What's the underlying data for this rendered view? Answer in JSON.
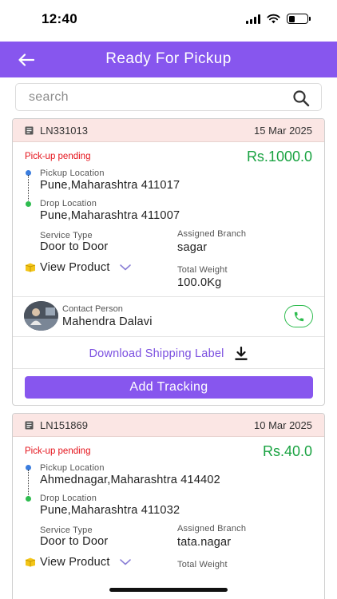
{
  "status_bar": {
    "time": "12:40",
    "battery_level": 0.35
  },
  "header": {
    "title": "Ready For Pickup"
  },
  "search": {
    "placeholder": "search"
  },
  "orders": [
    {
      "id": "LN331013",
      "date": "15 Mar 2025",
      "status": "Pick-up pending",
      "price_prefix": "Rs.",
      "price_amount": "1000.0",
      "pickup_label": "Pickup Location",
      "pickup_value": "Pune,Maharashtra 411017",
      "drop_label": "Drop Location",
      "drop_value": "Pune,Maharashtra 411007",
      "service_type_label": "Service Type",
      "service_type_value": "Door to Door",
      "branch_label": "Assigned Branch",
      "branch_value": "sagar",
      "view_product_label": "View Product",
      "weight_label": "Total Weight",
      "weight_value": "100.0Kg",
      "contact_label": "Contact Person",
      "contact_name": "Mahendra Dalavi",
      "download_label": "Download Shipping Label",
      "add_tracking_label": "Add Tracking"
    },
    {
      "id": "LN151869",
      "date": "10 Mar 2025",
      "status": "Pick-up pending",
      "price_prefix": "Rs.",
      "price_amount": "40.0",
      "pickup_label": "Pickup Location",
      "pickup_value": "Ahmednagar,Maharashtra 414402",
      "drop_label": "Drop Location",
      "drop_value": "Pune,Maharashtra 411032",
      "service_type_label": "Service Type",
      "service_type_value": "Door to Door",
      "branch_label": "Assigned Branch",
      "branch_value": "tata.nagar",
      "view_product_label": "View Product",
      "weight_label": "Total Weight"
    }
  ],
  "colors": {
    "accent": "#8756ee",
    "status_pending": "#e5131b",
    "price": "#1aa342",
    "card_header_bg": "#fbe6e4",
    "pickup_dot": "#3b7dde",
    "drop_dot": "#2ebc4f"
  },
  "icons": {
    "back": "arrow-left-icon",
    "search": "magnifier-icon",
    "order": "document-icon",
    "product": "box-icon",
    "expand": "chevron-down-icon",
    "call": "phone-icon",
    "download": "download-icon"
  }
}
